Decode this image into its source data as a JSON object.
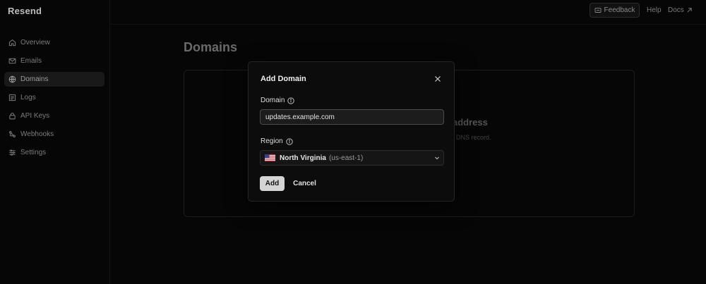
{
  "app": {
    "brand": "Resend"
  },
  "sidebar": {
    "items": [
      {
        "label": "Overview",
        "icon": "home-icon",
        "active": false
      },
      {
        "label": "Emails",
        "icon": "mail-icon",
        "active": false
      },
      {
        "label": "Domains",
        "icon": "globe-icon",
        "active": true
      },
      {
        "label": "Logs",
        "icon": "list-icon",
        "active": false
      },
      {
        "label": "API Keys",
        "icon": "lock-icon",
        "active": false
      },
      {
        "label": "Webhooks",
        "icon": "webhook-icon",
        "active": false
      },
      {
        "label": "Settings",
        "icon": "sliders-icon",
        "active": false
      }
    ]
  },
  "topbar": {
    "feedback_label": "Feedback",
    "help_label": "Help",
    "docs_label": "Docs"
  },
  "main": {
    "title": "Domains",
    "empty_heading_visible": "address",
    "empty_sub_visible": "g a DNS record."
  },
  "modal": {
    "title": "Add Domain",
    "domain_label": "Domain",
    "domain_value": "updates.example.com",
    "region_label": "Region",
    "region_name": "North Virginia",
    "region_code": "(us-east-1)",
    "add_label": "Add",
    "cancel_label": "Cancel"
  },
  "colors": {
    "background": "#060606",
    "modal_bg": "#0c0c0c",
    "primary_button": "#d4d4d4",
    "active_nav": "#191919"
  }
}
